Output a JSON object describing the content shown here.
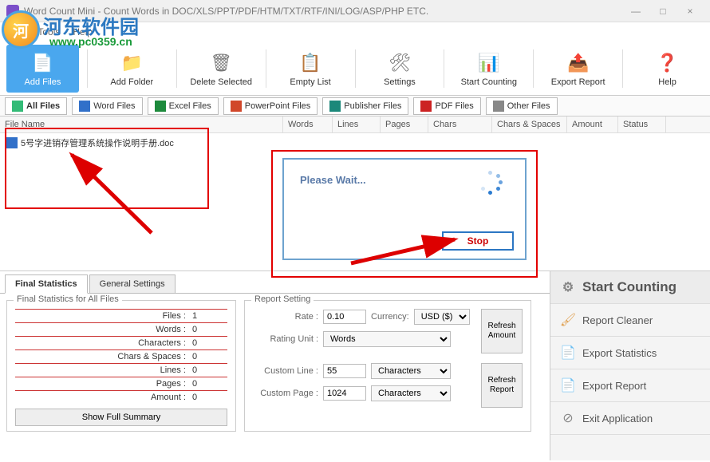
{
  "window": {
    "title": "Word Count Mini - Count Words in DOC/XLS/PPT/PDF/HTM/TXT/RTF/INI/LOG/ASP/PHP ETC.",
    "min": "—",
    "max": "□",
    "close": "×"
  },
  "menu": {
    "file": "File",
    "tools": "Tools",
    "help": "Help"
  },
  "watermark": {
    "site": "河东软件园",
    "url": "www.pc0359.cn"
  },
  "toolbar": {
    "add_files": "Add Files",
    "add_folder": "Add Folder",
    "delete_selected": "Delete Selected",
    "empty_list": "Empty List",
    "settings": "Settings",
    "start_counting": "Start Counting",
    "export_report": "Export Report",
    "help": "Help"
  },
  "filetabs": {
    "all": "All Files",
    "word": "Word Files",
    "excel": "Excel Files",
    "ppt": "PowerPoint Files",
    "pub": "Publisher Files",
    "pdf": "PDF Files",
    "other": "Other Files"
  },
  "grid": {
    "headers": {
      "name": "File Name",
      "words": "Words",
      "lines": "Lines",
      "pages": "Pages",
      "chars": "Chars",
      "cs": "Chars & Spaces",
      "amount": "Amount",
      "status": "Status"
    },
    "rows": [
      {
        "name": "5号字进销存管理系统操作说明手册.doc"
      }
    ]
  },
  "dialog": {
    "msg": "Please Wait...",
    "stop": "Stop"
  },
  "bottom_tabs": {
    "final": "Final Statistics",
    "general": "General Settings"
  },
  "stats_fieldset": {
    "legend": "Final Statistics for All Files",
    "rows": {
      "files_l": "Files :",
      "files_v": "1",
      "words_l": "Words :",
      "words_v": "0",
      "chars_l": "Characters :",
      "chars_v": "0",
      "cs_l": "Chars & Spaces :",
      "cs_v": "0",
      "lines_l": "Lines :",
      "lines_v": "0",
      "pages_l": "Pages :",
      "pages_v": "0",
      "amount_l": "Amount :",
      "amount_v": "0"
    },
    "show_summary": "Show Full Summary"
  },
  "report_fieldset": {
    "legend": "Report Setting",
    "rate_l": "Rate :",
    "rate_v": "0.10",
    "currency_l": "Currency:",
    "currency_v": "USD ($)",
    "unit_l": "Rating Unit :",
    "unit_v": "Words",
    "cline_l": "Custom Line :",
    "cline_v": "55",
    "cline_unit": "Characters",
    "cpage_l": "Custom Page :",
    "cpage_v": "1024",
    "cpage_unit": "Characters",
    "refresh_amount": "Refresh Amount",
    "refresh_report": "Refresh Report"
  },
  "side": {
    "start": "Start Counting",
    "cleaner": "Report Cleaner",
    "export_stats": "Export Statistics",
    "export_report": "Export Report",
    "exit": "Exit Application"
  }
}
